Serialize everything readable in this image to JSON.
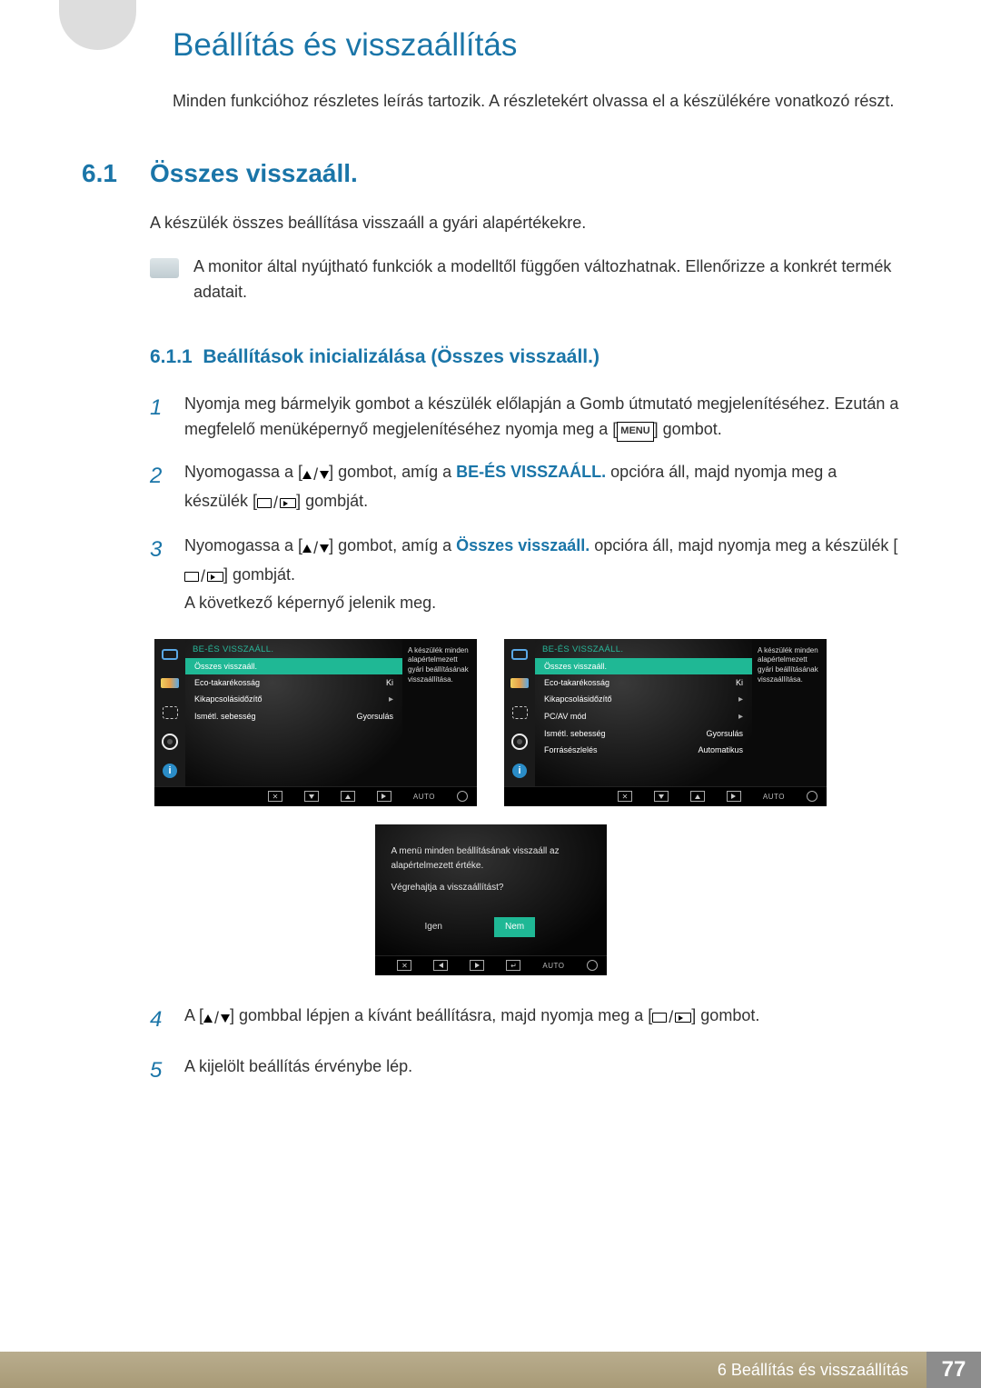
{
  "page": {
    "title": "Beállítás és visszaállítás",
    "intro": "Minden funkcióhoz részletes leírás tartozik. A részletekért olvassa el a készülékére vonatkozó részt.",
    "section_number": "6.1",
    "section_title": "Összes visszaáll.",
    "section_body": "A készülék összes beállítása visszaáll a gyári alapértékekre.",
    "note": "A monitor által nyújtható funkciók a modelltől függően változhatnak. Ellenőrizze a konkrét termék adatait.",
    "subhead_number": "6.1.1",
    "subhead_title": "Beállítások inicializálása (Összes visszaáll.)"
  },
  "steps": {
    "s1a": "Nyomja meg bármelyik gombot a készülék előlapján a Gomb útmutató megjelenítéséhez. Ezután a megfelelő menüképernyő megjelenítéséhez nyomja meg a [",
    "menu_label": "MENU",
    "s1b": "] gombot.",
    "s2a": "Nyomogassa a [",
    "s2b": "] gombot, amíg a ",
    "s2_bold": "BE-ÉS VISSZAÁLL.",
    "s2c": " opcióra áll, majd nyomja meg a készülék [",
    "s2d": "] gombját.",
    "s3a": "Nyomogassa a [",
    "s3b": "] gombot, amíg a ",
    "s3_bold": "Összes visszaáll.",
    "s3c": " opcióra áll, majd nyomja meg a készülék [",
    "s3d": "] gombját.",
    "s3e": "A következő képernyő jelenik meg.",
    "s4a": "A [",
    "s4b": "] gombbal lépjen a kívánt beállításra, majd nyomja meg a [",
    "s4c": "] gombot.",
    "s5": "A kijelölt beállítás érvénybe lép."
  },
  "osd": {
    "header": "BE-ÉS VISSZAÁLL.",
    "tooltip": "A készülék minden alapértelmezett gyári beállításának visszaállítása.",
    "auto": "AUTO",
    "menu1": {
      "items": [
        {
          "label": "Összes visszaáll.",
          "value": "",
          "selected": true
        },
        {
          "label": "Eco-takarékosság",
          "value": "Ki"
        },
        {
          "label": "Kikapcsolásidőzítő",
          "value": "▸"
        },
        {
          "label": "Ismétl. sebesség",
          "value": "Gyorsulás"
        }
      ]
    },
    "menu2": {
      "items": [
        {
          "label": "Összes visszaáll.",
          "value": "",
          "selected": true
        },
        {
          "label": "Eco-takarékosság",
          "value": "Ki"
        },
        {
          "label": "Kikapcsolásidőzítő",
          "value": "▸"
        },
        {
          "label": "PC/AV mód",
          "value": "▸"
        },
        {
          "label": "Ismétl. sebesség",
          "value": "Gyorsulás"
        },
        {
          "label": "Forrásészlelés",
          "value": "Automatikus"
        }
      ]
    }
  },
  "confirm": {
    "line1": "A menü minden beállításának visszaáll az alapértelmezett értéke.",
    "line2": "Végrehajtja a visszaállítást?",
    "yes": "Igen",
    "no": "Nem",
    "auto": "AUTO"
  },
  "footer": {
    "text": "6 Beállítás és visszaállítás",
    "page": "77"
  }
}
